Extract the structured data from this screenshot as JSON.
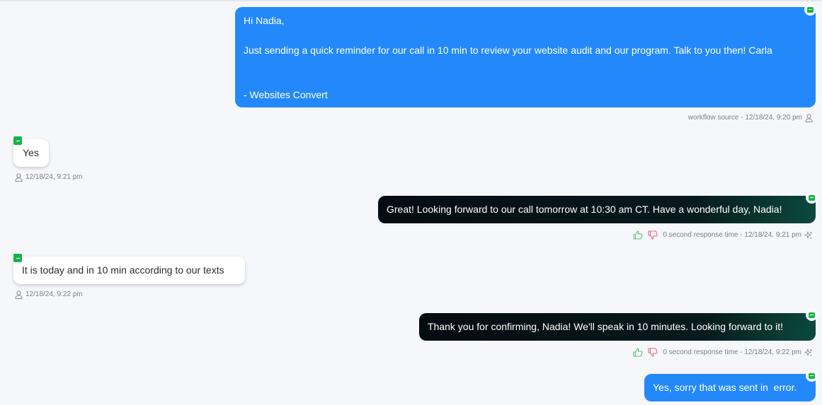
{
  "thread": {
    "messages": [
      {
        "direction": "outbound",
        "style": "manual",
        "text": "Hi Nadia,\n\nJust sending a quick reminder for our call in 10 min to review your website audit and our program. Talk to you then! Carla\n\n\n- Websites Convert",
        "meta": "workflow source - 12/18/24, 9:20 pm",
        "meta_icon": "user-icon"
      },
      {
        "direction": "inbound",
        "text": "Yes",
        "meta": "12/18/24, 9:21 pm",
        "meta_icon": "user-icon"
      },
      {
        "direction": "outbound",
        "style": "ai",
        "text": "Great! Looking forward to our call tomorrow at 10:30 am CT. Have a wonderful day, Nadia!",
        "meta": "0 second response time - 12/18/24, 9:21 pm",
        "meta_icon": "sparkle-icon",
        "feedback": [
          "thumbs-up-icon",
          "thumbs-down-icon"
        ]
      },
      {
        "direction": "inbound",
        "text": "It is today and in 10 min according to our texts",
        "meta": "12/18/24, 9:22 pm",
        "meta_icon": "user-icon"
      },
      {
        "direction": "outbound",
        "style": "ai",
        "text": "Thank you for confirming, Nadia! We'll speak in 10 minutes. Looking forward to it!",
        "meta": "0 second response time - 12/18/24, 9:22 pm",
        "meta_icon": "sparkle-icon",
        "feedback": [
          "thumbs-up-icon",
          "thumbs-down-icon"
        ]
      },
      {
        "direction": "outbound",
        "style": "manual",
        "text": "Yes, sorry that was sent in  error."
      }
    ]
  },
  "colors": {
    "background": "#f6f7fb",
    "outbound_blue": "#2389fa",
    "ai_gradient_dark": "#050b12",
    "ai_gradient_teal": "#0b4a3e",
    "sms_channel_green": "#19b24a",
    "thumbs_up": "#5cc26a",
    "thumbs_down": "#e26c6c",
    "meta_text": "#7c7f87"
  }
}
